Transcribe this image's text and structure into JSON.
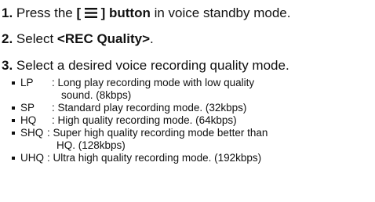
{
  "step1": {
    "number": "1.",
    "before": "Press the",
    "button_open": "[",
    "button_close": "] button",
    "after": "in voice standby mode.",
    "icon": "menu-icon"
  },
  "step2": {
    "number": "2.",
    "before": "Select",
    "menu": "<REC Quality>",
    "after": "."
  },
  "step3": {
    "number": "3.",
    "text": "Select a desired voice recording quality mode."
  },
  "modes": [
    {
      "label": "LP",
      "desc": "Long play recording mode with low quality",
      "desc_cont": "sound. (8kbps)"
    },
    {
      "label": "SP",
      "desc": "Standard play recording mode. (32kbps)"
    },
    {
      "label": "HQ",
      "desc": "High quality recording mode. (64kbps)"
    },
    {
      "label": "SHQ",
      "desc": "Super high quality recording mode better than",
      "desc_cont": "HQ. (128kbps)"
    },
    {
      "label": "UHQ",
      "desc": "Ultra high quality recording mode. (192kbps)"
    }
  ]
}
